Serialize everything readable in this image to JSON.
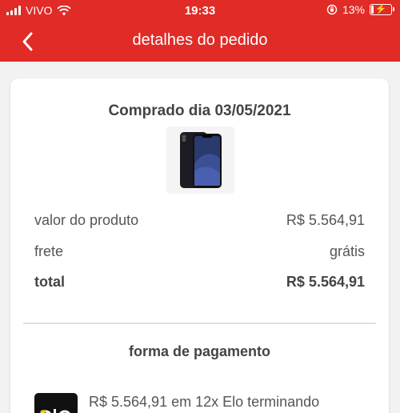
{
  "status_bar": {
    "carrier": "VIVO",
    "time": "19:33",
    "battery_percent": "13%",
    "battery_level": 0.13
  },
  "header": {
    "title": "detalhes do pedido"
  },
  "order": {
    "purchase_date": "Comprado dia 03/05/2021",
    "rows": [
      {
        "label": "valor do produto",
        "value": "R$ 5.564,91"
      },
      {
        "label": "frete",
        "value": "grátis"
      },
      {
        "label": "total",
        "value": "R$ 5.564,91"
      }
    ]
  },
  "payment": {
    "section_title": "forma de pagamento",
    "description": "R$ 5.564,91 em 12x Elo terminando"
  },
  "colors": {
    "brand_red": "#e02b27"
  }
}
